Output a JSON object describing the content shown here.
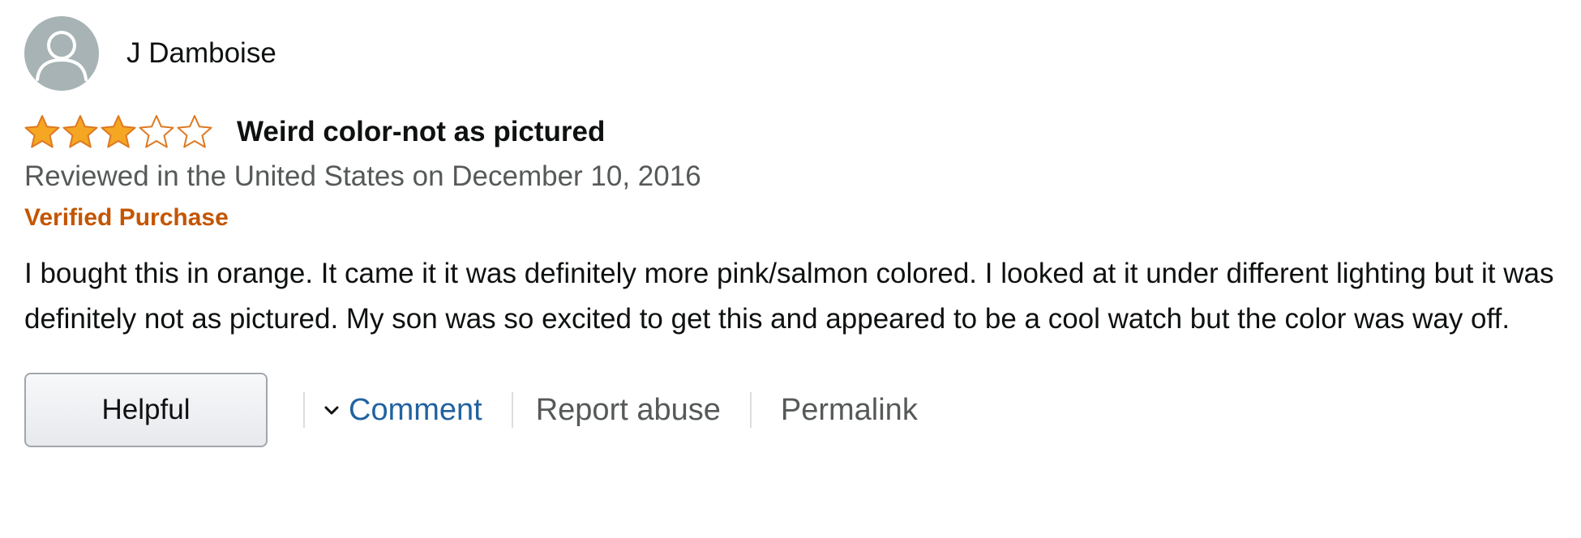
{
  "review": {
    "profile_name": "J Damboise",
    "rating": 3,
    "rating_max": 5,
    "title": "Weird color-not as pictured",
    "date_line": "Reviewed in the United States on December 10, 2016",
    "badge": "Verified Purchase",
    "body": "I bought this in orange. It came it it was definitely more pink/salmon colored. I looked at it under different lighting but it was definitely not as pictured. My son was so excited to get this and appeared to be a cool watch but the color was way off."
  },
  "actions": {
    "helpful_label": "Helpful",
    "comment_label": "Comment",
    "report_label": "Report abuse",
    "permalink_label": "Permalink"
  },
  "colors": {
    "star_fill": "#f5a623",
    "star_outline": "#de7921",
    "badge": "#c45500",
    "link": "#2162a1",
    "secondary_text": "#565959"
  },
  "icons": {
    "avatar": "default-user-avatar-icon",
    "star_filled": "star-filled-icon",
    "star_empty": "star-empty-icon",
    "comment_toggle": "chevron-down-icon"
  }
}
